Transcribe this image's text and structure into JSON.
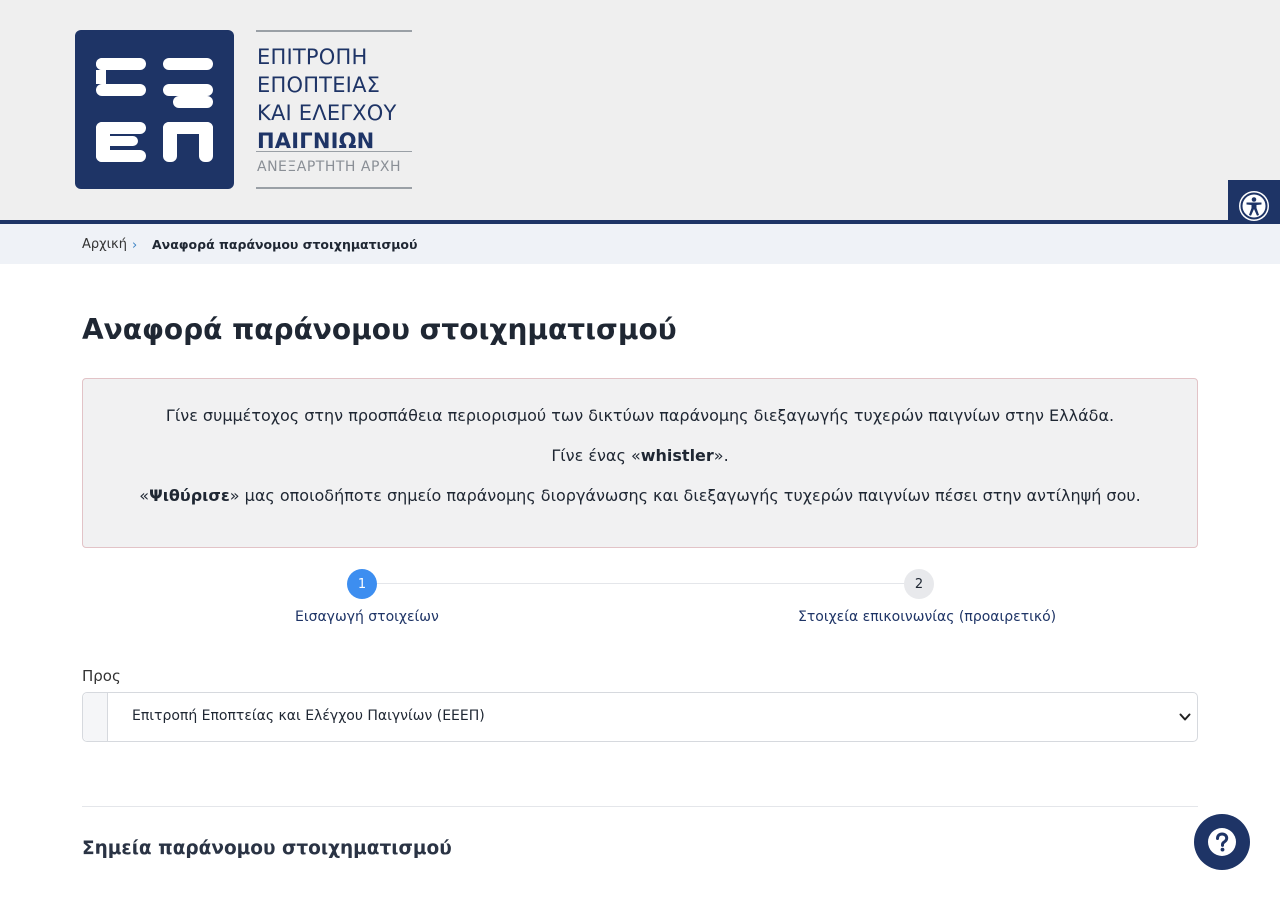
{
  "logo": {
    "mark": "ΕΕ ΕΠ",
    "line1": "ΕΠΙΤΡΟΠΗ",
    "line2": "ΕΠΟΠΤΕΙΑΣ",
    "line3": "ΚΑΙ ΕΛΕΓΧΟΥ",
    "line4": "ΠΑΙΓΝΙΩΝ",
    "subtitle": "ΑΝΕΞΑΡΤΗΤΗ ΑΡΧΗ"
  },
  "breadcrumb": {
    "home": "Αρχική",
    "separator": "›",
    "current": "Αναφορά παράνομου στοιχηματισμού"
  },
  "page": {
    "title": "Αναφορά παράνομου στοιχηματισμού"
  },
  "info": {
    "p1": "Γίνε συμμέτοχος στην προσπάθεια περιορισμού των δικτύων παράνομης διεξαγωγής τυχερών παιγνίων στην Ελλάδα.",
    "p2_before": "Γίνε ένας «",
    "p2_bold": "whistler",
    "p2_after": "».",
    "p3_before": "«",
    "p3_bold": "Ψιθύρισε",
    "p3_after": "» μας οποιοδήποτε σημείο παράνομης διοργάνωσης και διεξαγωγής τυχερών παιγνίων πέσει στην αντίληψή σου."
  },
  "stepper": {
    "steps": [
      {
        "number": "1",
        "label": "Εισαγωγή στοιχείων",
        "active": true
      },
      {
        "number": "2",
        "label": "Στοιχεία επικοινωνίας (προαιρετικό)",
        "active": false
      }
    ]
  },
  "form": {
    "to_label": "Προς",
    "to_value": "Επιτροπή Εποπτείας και Ελέγχου Παιγνίων (ΕΕΕΠ)"
  },
  "section": {
    "title": "Σημεία παράνομου στοιχηματισμού"
  },
  "icons": {
    "accessibility": "accessibility-icon",
    "help": "question-mark-icon",
    "chevron": "chevron-down-icon"
  },
  "colors": {
    "brand_navy": "#1e3466",
    "step_active": "#3d8ef0",
    "info_border": "#e2c3c7"
  }
}
